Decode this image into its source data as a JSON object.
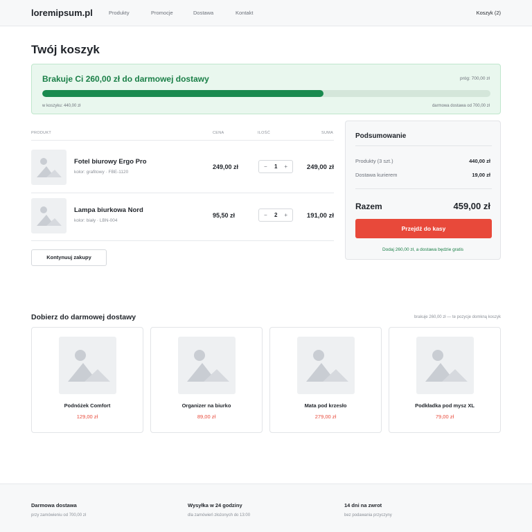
{
  "header": {
    "logo": "loremipsum.pl",
    "nav": [
      "Produkty",
      "Promocje",
      "Dostawa",
      "Kontakt"
    ],
    "cart": "Koszyk (2)"
  },
  "page_title": "Twój koszyk",
  "banner": {
    "title": "Brakuje Ci 260,00 zł do darmowej dostawy",
    "threshold": "próg: 700,00 zł",
    "progress": 0.628,
    "in_cart": "w koszyku: 440,00 zł",
    "free_from": "darmowa dostawa od 700,00 zł"
  },
  "table": {
    "headers": {
      "product": "PRODUKT",
      "price": "CENA",
      "qty": "ILOŚĆ",
      "sum": "SUMA"
    },
    "items": [
      {
        "name": "Fotel biurowy Ergo Pro",
        "meta": "kolor: grafitowy · FBE-1120",
        "price": "249,00 zł",
        "qty": "1",
        "sum": "249,00 zł"
      },
      {
        "name": "Lampa biurkowa Nord",
        "meta": "kolor: biały · LBN-004",
        "price": "95,50 zł",
        "qty": "2",
        "sum": "191,00 zł"
      }
    ],
    "minus": "−",
    "plus": "+"
  },
  "continue_label": "Kontynuuj zakupy",
  "summary": {
    "title": "Podsumowanie",
    "products_label": "Produkty (3 szt.)",
    "products_value": "440,00 zł",
    "shipping_label": "Dostawa kurierem",
    "shipping_value": "19,00 zł",
    "total_label": "Razem",
    "total_value": "459,00 zł",
    "checkout": "Przejdź do kasy",
    "note": "Dodaj 260,00 zł, a dostawa będzie gratis"
  },
  "recommend": {
    "title": "Dobierz do darmowej dostawy",
    "hint": "brakuje 260,00 zł — te pozycje domkną koszyk",
    "items": [
      {
        "name": "Podnóżek Comfort",
        "price": "129,00 zł"
      },
      {
        "name": "Organizer na biurko",
        "price": "89,00 zł"
      },
      {
        "name": "Mata pod krzesło",
        "price": "279,00 zł"
      },
      {
        "name": "Podkładka pod mysz XL",
        "price": "79,00 zł"
      }
    ]
  },
  "footer": [
    {
      "title": "Darmowa dostawa",
      "sub": "przy zamówieniu od 700,00 zł"
    },
    {
      "title": "Wysyłka w 24 godziny",
      "sub": "dla zamówień złożonych do 13:00"
    },
    {
      "title": "14 dni na zwrot",
      "sub": "bez podawania przyczyny"
    }
  ],
  "colors": {
    "accent": "#e8493a",
    "success": "#1a8a4f",
    "banner_bg": "#e9f7ee"
  },
  "icons": {
    "product_placeholder": "image-placeholder-icon"
  }
}
